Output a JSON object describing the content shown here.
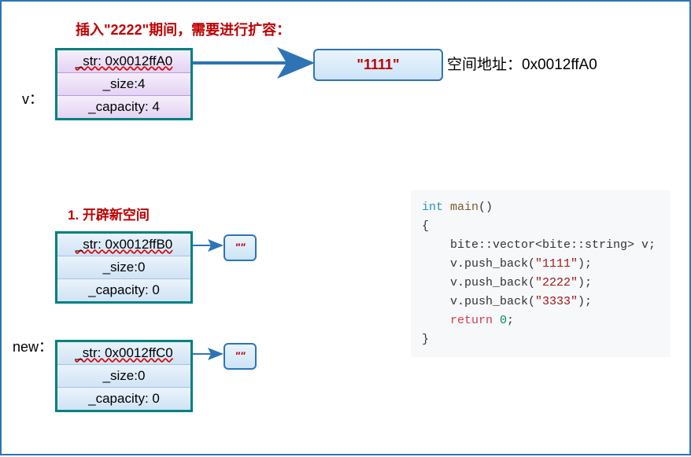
{
  "heading": "插入\"2222\"期间，需要进行扩容：",
  "v_label": "v：",
  "struct_v": {
    "str": "_str: 0x0012ffA0",
    "size": "_size:4",
    "cap": "_capacity: 4"
  },
  "value_1111": "\"1111\"",
  "addr_label": "空间地址：0x0012ffA0",
  "step1_heading": "1. 开辟新空间",
  "new_label": "new：",
  "struct_new1": {
    "str": "_str: 0x0012ffB0",
    "size": "_size:0",
    "cap": "_capacity: 0"
  },
  "struct_new2": {
    "str": "_str: 0x0012ffC0",
    "size": "_size:0",
    "cap": "_capacity: 0"
  },
  "empty_lit": "\"\"",
  "code": {
    "l1a": "int",
    "l1b": " main",
    "l1c": "()",
    "l2": "{",
    "l3": "    bite::vector<bite::string> v;",
    "l4a": "    v.push_back(",
    "l4b": "\"1111\"",
    "l4c": ");",
    "l5a": "    v.push_back(",
    "l5b": "\"2222\"",
    "l5c": ");",
    "l6a": "    v.push_back(",
    "l6b": "\"3333\"",
    "l6c": ");",
    "l7a": "    return",
    "l7b": " 0",
    "l7c": ";",
    "l8": "}"
  }
}
